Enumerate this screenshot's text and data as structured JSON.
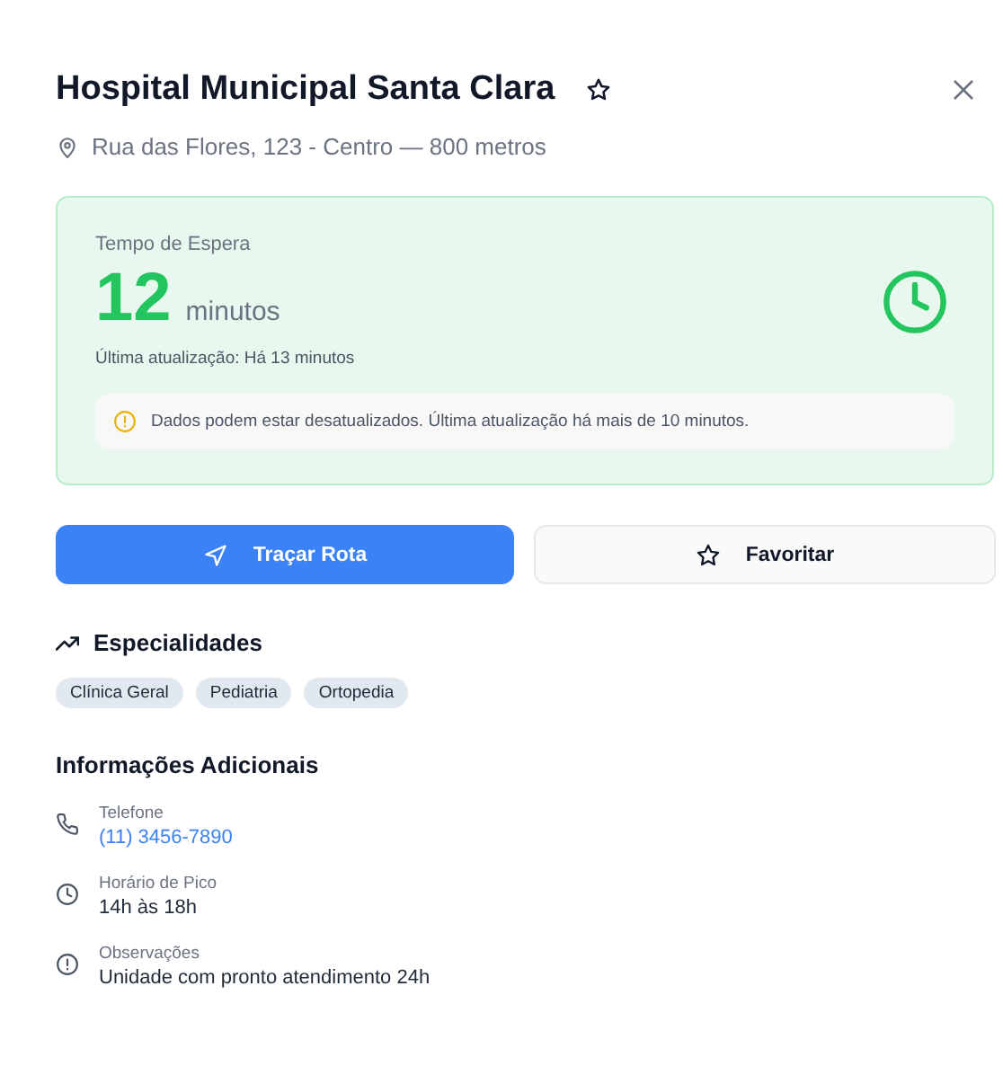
{
  "title": "Hospital Municipal Santa Clara",
  "address": "Rua das Flores, 123 - Centro — 800 metros",
  "wait": {
    "label": "Tempo de Espera",
    "value": "12",
    "unit": "minutos",
    "updated": "Última atualização: Há 13 minutos",
    "warning": "Dados podem estar desatualizados. Última atualização há mais de 10 minutos."
  },
  "buttons": [
    {
      "kind": "primary",
      "label": "Traçar Rota"
    },
    {
      "kind": "secondary",
      "label": "Favoritar"
    }
  ],
  "specialties": {
    "title": "Especialidades",
    "tags": [
      "Clínica Geral",
      "Pediatria",
      "Ortopedia"
    ]
  },
  "info": {
    "title": "Informações Adicionais",
    "items": [
      {
        "kind": "phone",
        "label": "Telefone",
        "value": "(11) 3456-7890"
      },
      {
        "kind": "clock",
        "label": "Horário de Pico",
        "value": "14h às 18h"
      },
      {
        "kind": "note",
        "label": "Observações",
        "value": "Unidade com pronto atendimento 24h"
      }
    ]
  }
}
